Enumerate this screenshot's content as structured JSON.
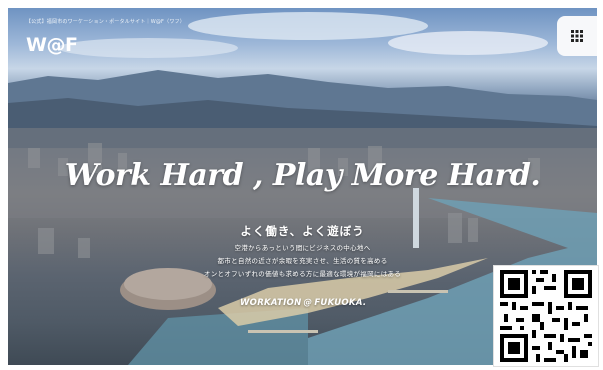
{
  "header": {
    "tagline": "【公式】福岡市のワーケーション・ポータルサイト｜W@F（ワフ）",
    "logo_text": "W@F"
  },
  "menu": {
    "icon": "grid-menu-icon"
  },
  "hero": {
    "headline": "Work Hard , Play More Hard.",
    "sub_headline": "よく働き、よく遊ぼう",
    "body_lines": [
      "空港からあっという間にビジネスの中心地へ",
      "都市と自然の近さが余暇を充実させ、生活の質を高める",
      "オンとオフいずれの価値も求める方に最適な環境が福岡にはある"
    ],
    "brand_mark": {
      "left": "WORKATION",
      "symbol": "@",
      "right": "FUKUOKA."
    }
  },
  "qr_code": {
    "icon": "qr-code-icon"
  }
}
